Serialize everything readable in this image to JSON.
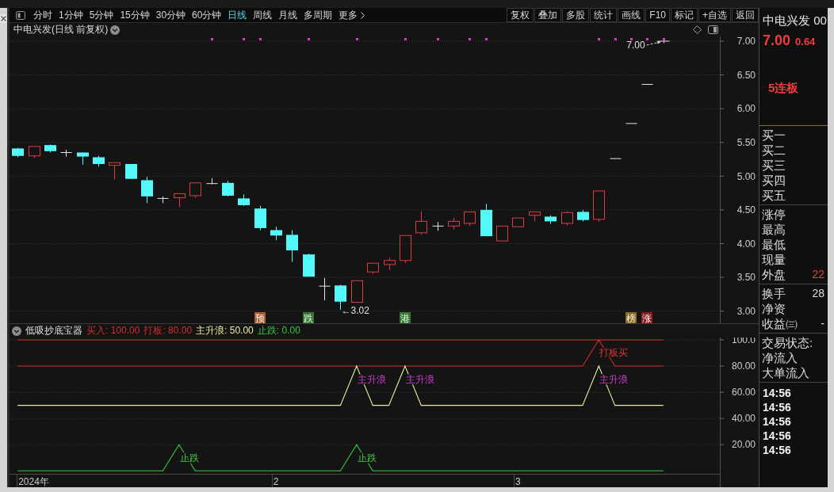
{
  "toolbar": {
    "periods": [
      {
        "label": "分时",
        "selected": false
      },
      {
        "label": "1分钟",
        "selected": false
      },
      {
        "label": "5分钟",
        "selected": false
      },
      {
        "label": "15分钟",
        "selected": false
      },
      {
        "label": "30分钟",
        "selected": false
      },
      {
        "label": "60分钟",
        "selected": false
      },
      {
        "label": "日线",
        "selected": true
      },
      {
        "label": "周线",
        "selected": false
      },
      {
        "label": "月线",
        "selected": false
      },
      {
        "label": "多周期",
        "selected": false
      }
    ],
    "more": "更多",
    "actions": [
      "复权",
      "叠加",
      "多股",
      "统计",
      "画线",
      "F10",
      "标记",
      "+自选",
      "返回"
    ]
  },
  "price_chart": {
    "title": "中电兴发(日线 前复权)",
    "chart_data": {
      "type": "candlestick",
      "categories": [
        null,
        null,
        null,
        null,
        null,
        null,
        null,
        null,
        null,
        null,
        null,
        null,
        null,
        null,
        null,
        "预",
        null,
        null,
        "跌",
        null,
        null,
        null,
        null,
        null,
        "港",
        null,
        null,
        null,
        null,
        null,
        null,
        null,
        null,
        null,
        null,
        null,
        null,
        null,
        "榜",
        "涨",
        null,
        null,
        null,
        null
      ],
      "ylim": [
        2.82,
        7.07
      ],
      "yticks": [
        {
          "value": 7,
          "label": "7.00"
        },
        {
          "value": 6.5,
          "label": "6.50"
        },
        {
          "value": 6,
          "label": "6.00"
        },
        {
          "value": 5.5,
          "label": "5.50"
        },
        {
          "value": 5,
          "label": "5.00"
        },
        {
          "value": 4.5,
          "label": "4.50"
        },
        {
          "value": 4,
          "label": "4.00"
        },
        {
          "value": 3.5,
          "label": "3.50"
        },
        {
          "value": 3,
          "label": "3.00"
        }
      ],
      "grid": true,
      "ohlc": [
        [
          5.41,
          5.42,
          5.28,
          5.3
        ],
        [
          5.3,
          5.44,
          5.27,
          5.44
        ],
        [
          5.46,
          5.47,
          5.35,
          5.37
        ],
        [
          5.35,
          5.39,
          5.29,
          5.35
        ],
        [
          5.35,
          5.35,
          5.17,
          5.29
        ],
        [
          5.28,
          5.3,
          5.14,
          5.18
        ],
        [
          5.16,
          5.2,
          4.95,
          5.2
        ],
        [
          5.18,
          5.18,
          4.96,
          4.96
        ],
        [
          4.94,
          4.99,
          4.6,
          4.7
        ],
        [
          4.67,
          4.7,
          4.6,
          4.67
        ],
        [
          4.68,
          4.74,
          4.54,
          4.74
        ],
        [
          4.71,
          4.9,
          4.68,
          4.9
        ],
        [
          4.89,
          4.97,
          4.88,
          4.89
        ],
        [
          4.9,
          4.93,
          4.7,
          4.71
        ],
        [
          4.67,
          4.73,
          4.56,
          4.57
        ],
        [
          4.52,
          4.56,
          4.2,
          4.23
        ],
        [
          4.2,
          4.25,
          4.05,
          4.12
        ],
        [
          4.13,
          4.2,
          3.73,
          3.9
        ],
        [
          3.84,
          3.85,
          3.51,
          3.51
        ],
        [
          3.37,
          3.49,
          3.16,
          3.37
        ],
        [
          3.38,
          3.39,
          3.02,
          3.14
        ],
        [
          3.13,
          3.45,
          3.12,
          3.45
        ],
        [
          3.58,
          3.71,
          3.55,
          3.71
        ],
        [
          3.69,
          3.79,
          3.61,
          3.75
        ],
        [
          3.75,
          4.12,
          3.71,
          4.12
        ],
        [
          4.16,
          4.48,
          4.13,
          4.33
        ],
        [
          4.26,
          4.32,
          4.19,
          4.26
        ],
        [
          4.26,
          4.38,
          4.21,
          4.33
        ],
        [
          4.3,
          4.47,
          4.26,
          4.47
        ],
        [
          4.5,
          4.59,
          4.11,
          4.11
        ],
        [
          4.04,
          4.26,
          4.04,
          4.26
        ],
        [
          4.25,
          4.38,
          4.25,
          4.38
        ],
        [
          4.42,
          4.47,
          4.33,
          4.47
        ],
        [
          4.4,
          4.42,
          4.29,
          4.33
        ],
        [
          4.3,
          4.48,
          4.27,
          4.46
        ],
        [
          4.47,
          4.5,
          4.33,
          4.35
        ],
        [
          4.36,
          4.78,
          4.32,
          4.78
        ],
        [
          5.26,
          5.26,
          5.26,
          5.26
        ],
        [
          5.78,
          5.78,
          5.78,
          5.78
        ],
        [
          6.36,
          6.36,
          6.36,
          6.36
        ],
        [
          7.0,
          7.0,
          6.97,
          7.0
        ],
        null,
        null,
        null
      ],
      "series": [
        {
          "type": "scatter",
          "color": "#cc44cc",
          "values": [
            null,
            null,
            null,
            null,
            null,
            null,
            null,
            null,
            null,
            null,
            null,
            null,
            7.03,
            null,
            7.03,
            7.03,
            null,
            null,
            7.03,
            null,
            null,
            7.03,
            null,
            null,
            7.03,
            null,
            7.03,
            null,
            7.03,
            7.03,
            null,
            null,
            null,
            null,
            null,
            null,
            7.03,
            7.03,
            7.03,
            7.03,
            7.03,
            null,
            null,
            null
          ]
        }
      ],
      "annotations": [
        "7.00",
        "←3.02"
      ]
    },
    "signal_tags": [
      {
        "color": "#a85a2a"
      },
      {
        "color": "#2f7a2f"
      },
      {
        "color": "#2f7a2f"
      },
      {
        "color": "#8a6a1e"
      },
      {
        "color": "#8c1c1c"
      }
    ]
  },
  "indicator": {
    "title": "低吸抄底宝器",
    "legend": [
      {
        "text": "买入: 100.00",
        "color": "#d42c2c"
      },
      {
        "text": "打板: 80.00",
        "color": "#d42c2c"
      },
      {
        "text": "主升浪: 50.00",
        "color": "#ecec9a"
      },
      {
        "text": "止跌: 0.00",
        "color": "#3cc83c"
      }
    ],
    "chart_data": {
      "type": "line",
      "categories": [
        null,
        "2024年",
        null,
        null,
        null,
        null,
        null,
        null,
        null,
        null,
        null,
        null,
        null,
        null,
        null,
        null,
        "2",
        null,
        null,
        null,
        null,
        null,
        null,
        null,
        null,
        null,
        null,
        null,
        null,
        null,
        null,
        "3",
        null,
        null,
        null,
        null,
        null,
        null,
        null,
        null,
        null,
        null,
        null,
        null
      ],
      "ylim": [
        -2.25,
        101.8
      ],
      "yticks": [
        {
          "value": 100,
          "label": "100.0"
        },
        {
          "value": 80,
          "label": "80.00"
        },
        {
          "value": 60,
          "label": "60.00"
        },
        {
          "value": 40,
          "label": "40.00"
        },
        {
          "value": 20,
          "label": "20.00"
        }
      ],
      "grid": true,
      "series": [
        {
          "color": "#d42c2c",
          "values": [
            100,
            100,
            100,
            100,
            100,
            100,
            100,
            100,
            100,
            100,
            100,
            100,
            100,
            100,
            100,
            100,
            100,
            100,
            100,
            100,
            100,
            100,
            100,
            100,
            100,
            100,
            100,
            100,
            100,
            100,
            100,
            100,
            100,
            100,
            100,
            100,
            100,
            100,
            100,
            100,
            100,
            null,
            null,
            null
          ]
        },
        {
          "color": "#d42c2c",
          "values": [
            80,
            80,
            80,
            80,
            80,
            80,
            80,
            80,
            80,
            80,
            80,
            80,
            80,
            80,
            80,
            80,
            80,
            80,
            80,
            80,
            80,
            80,
            80,
            80,
            80,
            80,
            80,
            80,
            80,
            80,
            80,
            80,
            80,
            80,
            80,
            80,
            100,
            80,
            80,
            80,
            80,
            null,
            null,
            null
          ]
        },
        {
          "color": "#ecec9a",
          "values": [
            50,
            50,
            50,
            50,
            50,
            50,
            50,
            50,
            50,
            50,
            50,
            50,
            50,
            50,
            50,
            50,
            50,
            50,
            50,
            50,
            50,
            80,
            50,
            50,
            80,
            50,
            50,
            50,
            50,
            50,
            50,
            50,
            50,
            50,
            50,
            50,
            80,
            50,
            50,
            50,
            50,
            null,
            null,
            null
          ]
        },
        {
          "color": "#3cc83c",
          "values": [
            0,
            0,
            0,
            0,
            0,
            0,
            0,
            0,
            0,
            0,
            20,
            0,
            0,
            0,
            0,
            0,
            0,
            0,
            0,
            0,
            0,
            20,
            0,
            0,
            0,
            0,
            0,
            0,
            0,
            0,
            0,
            0,
            0,
            0,
            0,
            0,
            0,
            0,
            0,
            0,
            0,
            null,
            null,
            null
          ]
        }
      ],
      "annotations": [
        "打板买",
        "主升浪",
        "主升浪",
        "主升浪",
        "止跌",
        "止跌"
      ]
    }
  },
  "quote_panel": {
    "title": "中电兴发 00",
    "price": "7.00",
    "change": "0.64",
    "note": "5连板",
    "sections": [
      {
        "rows": [
          {
            "label": "买一"
          },
          {
            "label": "买二"
          },
          {
            "label": "买三"
          },
          {
            "label": "买四"
          },
          {
            "label": "买五"
          }
        ]
      },
      {
        "rows": [
          {
            "label": "涨停"
          },
          {
            "label": "最高"
          },
          {
            "label": "最低"
          },
          {
            "label": "现量"
          },
          {
            "label": "外盘",
            "value": "22",
            "color": "#ee3c3c"
          }
        ]
      },
      {
        "rows": [
          {
            "label": "换手",
            "value": "28",
            "color": "#dcdcdc"
          },
          {
            "label": "净资"
          },
          {
            "label": "收益㈢",
            "value": "-",
            "color": "#dcdcdc"
          }
        ]
      },
      {
        "rows": [
          {
            "label": "交易状态:"
          },
          {
            "label": "净流入"
          },
          {
            "label": "大单流入"
          }
        ]
      }
    ],
    "ticks": [
      "14:56",
      "14:56",
      "14:56",
      "14:56",
      "14:56"
    ]
  }
}
